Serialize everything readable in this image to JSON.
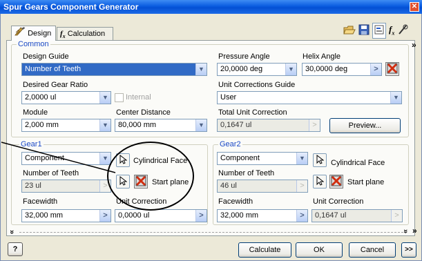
{
  "window": {
    "title": "Spur Gears Component Generator",
    "close_glyph": "✕"
  },
  "tabs": {
    "design": "Design",
    "calculation": "Calculation"
  },
  "toolbar": [
    "open-icon",
    "save-icon",
    "properties-icon",
    "fx-icon",
    "calculator-icon"
  ],
  "common": {
    "group_label": "Common",
    "design_guide_label": "Design Guide",
    "design_guide_value": "Number of Teeth",
    "pressure_angle_label": "Pressure Angle",
    "pressure_angle_value": "20,0000 deg",
    "helix_angle_label": "Helix Angle",
    "helix_angle_value": "30,0000 deg",
    "desired_gear_ratio_label": "Desired Gear Ratio",
    "desired_gear_ratio_value": "2,0000 ul",
    "internal_label": "Internal",
    "unit_corrections_guide_label": "Unit Corrections Guide",
    "unit_corrections_guide_value": "User",
    "module_label": "Module",
    "module_value": "2,000 mm",
    "center_distance_label": "Center Distance",
    "center_distance_value": "80,000 mm",
    "total_unit_correction_label": "Total Unit Correction",
    "total_unit_correction_value": "0,1647 ul",
    "preview_label": "Preview..."
  },
  "gear1": {
    "group_label": "Gear1",
    "type_value": "Component",
    "cylindrical_face_label": "Cylindrical Face",
    "start_plane_label": "Start plane",
    "teeth_label": "Number of Teeth",
    "teeth_value": "23 ul",
    "facewidth_label": "Facewidth",
    "facewidth_value": "32,000 mm",
    "unit_correction_label": "Unit Correction",
    "unit_correction_value": "0,0000 ul"
  },
  "gear2": {
    "group_label": "Gear2",
    "type_value": "Component",
    "cylindrical_face_label": "Cylindrical Face",
    "start_plane_label": "Start plane",
    "teeth_label": "Number of Teeth",
    "teeth_value": "46 ul",
    "facewidth_label": "Facewidth",
    "facewidth_value": "32,000 mm",
    "unit_correction_label": "Unit Correction",
    "unit_correction_value": "0,1647 ul"
  },
  "footer": {
    "help_label": "?",
    "calculate_label": "Calculate",
    "ok_label": "OK",
    "cancel_label": "Cancel",
    "more_label": ">>"
  },
  "glyphs": {
    "dropdown": "▼",
    "arrow": ">",
    "collapse": "»",
    "expand": "»"
  }
}
